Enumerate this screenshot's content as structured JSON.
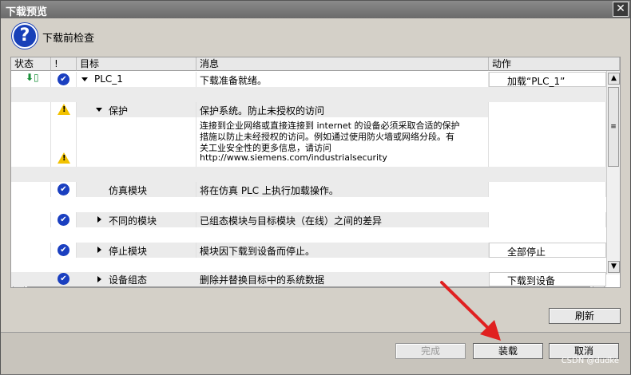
{
  "window": {
    "title": "下载预览"
  },
  "header": {
    "title": "下载前检查"
  },
  "grid": {
    "columns": {
      "status": "状态",
      "warning": "!",
      "target": "目标",
      "message": "消息",
      "action": "动作"
    },
    "rows": [
      {
        "target": "PLC_1",
        "message": "下载准备就绪。",
        "action": "加载“PLC_1”",
        "status_icon": "download-status-icon",
        "flag_icon": "check-warning-icon"
      },
      {
        "target": "保护",
        "message": "保护系统。防止未授权的访问",
        "action": "",
        "flag_icon": "warning-icon"
      },
      {
        "message_lines": [
          "连接到企业网络或直接连接到 internet 的设备必须采取合适的保护",
          "措施以防止未经授权的访问。例如通过使用防火墙或网络分段。有",
          "关工业安全性的更多信息，请访问",
          "http://www.siemens.com/industrialsecurity"
        ],
        "flag_icon": "warning-icon"
      },
      {
        "target": "仿真模块",
        "message": "将在仿真 PLC 上执行加载操作。",
        "action": "",
        "flag_icon": "check-icon"
      },
      {
        "target": "不同的模块",
        "message": "已组态模块与目标模块（在线）之间的差异",
        "action": "",
        "flag_icon": "check-icon"
      },
      {
        "target": "停止模块",
        "message": "模块因下载到设备而停止。",
        "action": "全部停止",
        "flag_icon": "check-icon"
      },
      {
        "target": "设备组态",
        "message": "删除并替换目标中的系统数据",
        "action": "下载到设备",
        "flag_icon": "check-icon"
      }
    ]
  },
  "buttons": {
    "refresh": "刷新",
    "finish": "完成",
    "load": "装载",
    "cancel": "取消"
  },
  "watermark": "CSDN @dudke",
  "colors": {
    "accent": "#1a3fc0",
    "warning": "#f2c200",
    "arrow": "#e02020"
  }
}
